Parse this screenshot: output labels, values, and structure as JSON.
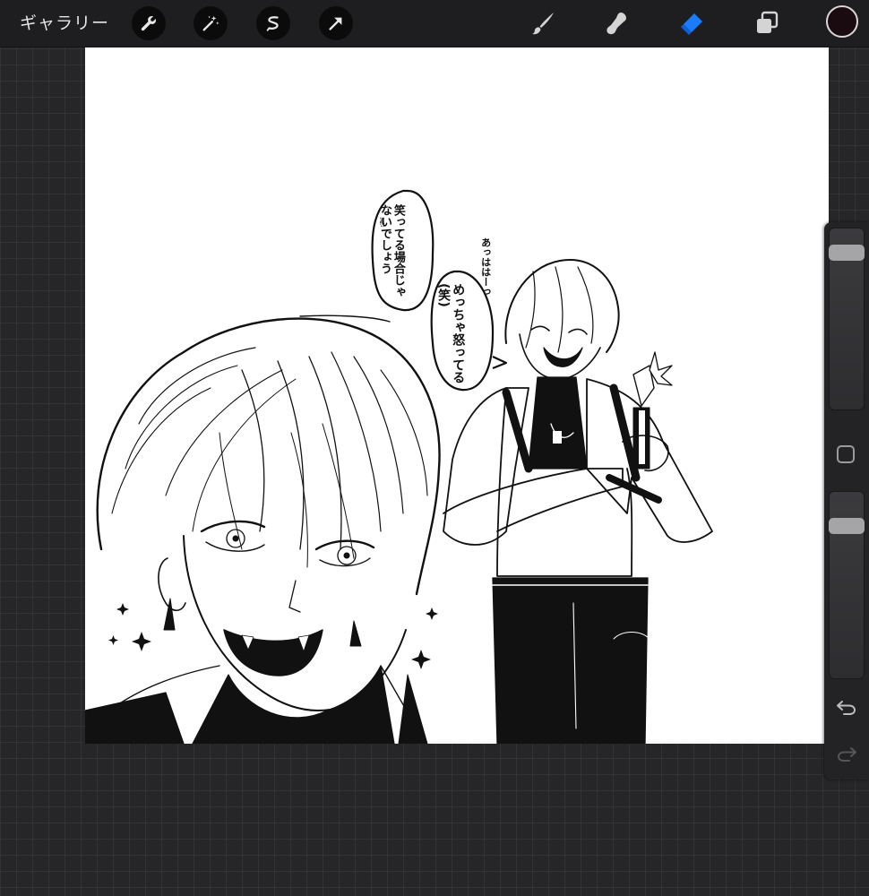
{
  "toolbar": {
    "gallery_label": "ギャラリー",
    "left_tools": [
      "wrench-icon",
      "magic-wand-icon",
      "selection-icon",
      "transform-arrow-icon"
    ],
    "right_tools": [
      "brush-icon",
      "smudge-icon",
      "eraser-icon",
      "layers-icon"
    ],
    "active_tool": "eraser",
    "active_color": "#1a0b10",
    "accent_color": "#1a7cff"
  },
  "canvas": {
    "bubble_left": {
      "lines": [
        "笑ってる",
        "場合じゃ",
        "ないでしょう"
      ],
      "mark": "✌"
    },
    "bubble_right": {
      "lines": [
        "めっちゃ",
        "怒ってる",
        "(笑)"
      ]
    },
    "laugh_text": {
      "lines": [
        "あっはは",
        "ーっ"
      ]
    }
  },
  "sidebar": {
    "brush_size_level": 0.9,
    "opacity_level": 0.85
  }
}
